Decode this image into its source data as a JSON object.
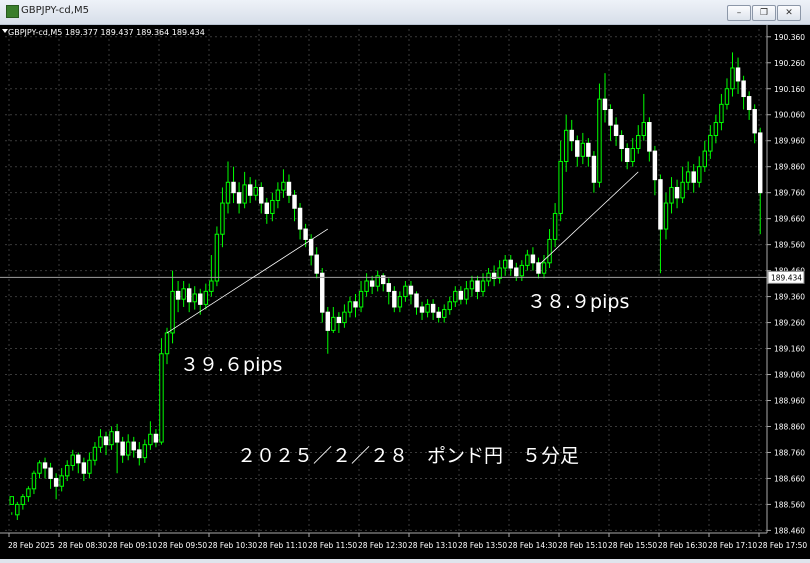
{
  "window": {
    "title": "GBPJPY-cd,M5",
    "buttons": [
      "minimize",
      "restore",
      "close"
    ]
  },
  "chart_data": {
    "type": "candlestick",
    "symbol_info": "GBPJPY-cd,M5  189.377 189.437 189.364 189.434",
    "ylim": [
      188.45,
      190.39
    ],
    "y_ticks": [
      "190.360",
      "190.260",
      "190.160",
      "190.060",
      "189.960",
      "189.860",
      "189.760",
      "189.660",
      "189.560",
      "189.460",
      "189.360",
      "189.260",
      "189.160",
      "189.060",
      "188.960",
      "188.860",
      "188.760",
      "188.660",
      "188.560",
      "188.460"
    ],
    "current_price": "189.434",
    "x_ticks": [
      "28 Feb 2025",
      "28 Feb 08:30",
      "28 Feb 09:10",
      "28 Feb 09:50",
      "28 Feb 10:30",
      "28 Feb 11:10",
      "28 Feb 11:50",
      "28 Feb 12:30",
      "28 Feb 13:10",
      "28 Feb 13:50",
      "28 Feb 14:30",
      "28 Feb 15:10",
      "28 Feb 15:50",
      "28 Feb 16:30",
      "28 Feb 17:10",
      "28 Feb 17:50"
    ],
    "candles": [
      [
        188.56,
        188.59,
        188.53,
        188.52
      ],
      [
        188.52,
        188.56,
        188.57,
        188.5
      ],
      [
        188.56,
        188.59,
        188.6,
        188.54
      ],
      [
        188.59,
        188.62,
        188.63,
        188.57
      ],
      [
        188.62,
        188.68,
        188.69,
        188.6
      ],
      [
        188.68,
        188.72,
        188.73,
        188.66
      ],
      [
        188.72,
        188.7,
        188.74,
        188.66
      ],
      [
        188.7,
        188.66,
        188.72,
        188.62
      ],
      [
        188.66,
        188.63,
        188.68,
        188.58
      ],
      [
        188.63,
        188.67,
        188.7,
        188.61
      ],
      [
        188.67,
        188.71,
        188.73,
        188.65
      ],
      [
        188.71,
        188.75,
        188.77,
        188.69
      ],
      [
        188.75,
        188.72,
        188.76,
        188.68
      ],
      [
        188.72,
        188.68,
        188.74,
        188.65
      ],
      [
        188.68,
        188.73,
        188.76,
        188.66
      ],
      [
        188.73,
        188.78,
        188.8,
        188.71
      ],
      [
        188.78,
        188.82,
        188.85,
        188.76
      ],
      [
        188.82,
        188.79,
        188.84,
        188.75
      ],
      [
        188.79,
        188.84,
        188.86,
        188.77
      ],
      [
        188.84,
        188.8,
        188.87,
        188.68
      ],
      [
        188.8,
        188.75,
        188.82,
        188.72
      ],
      [
        188.75,
        188.8,
        188.83,
        188.73
      ],
      [
        188.8,
        188.77,
        188.82,
        188.74
      ],
      [
        188.77,
        188.74,
        188.8,
        188.71
      ],
      [
        188.74,
        188.79,
        188.81,
        188.72
      ],
      [
        188.79,
        188.83,
        188.88,
        188.77
      ],
      [
        188.83,
        188.8,
        188.85,
        188.78
      ],
      [
        188.8,
        189.14,
        189.2,
        188.79
      ],
      [
        189.14,
        189.22,
        189.24,
        189.1
      ],
      [
        189.22,
        189.38,
        189.46,
        189.18
      ],
      [
        189.38,
        189.35,
        189.42,
        189.3
      ],
      [
        189.35,
        189.39,
        189.42,
        189.32
      ],
      [
        189.39,
        189.34,
        189.41,
        189.3
      ],
      [
        189.34,
        189.37,
        189.4,
        189.31
      ],
      [
        189.37,
        189.33,
        189.39,
        189.29
      ],
      [
        189.33,
        189.38,
        189.41,
        189.31
      ],
      [
        189.38,
        189.42,
        189.52,
        189.36
      ],
      [
        189.42,
        189.6,
        189.63,
        189.4
      ],
      [
        189.6,
        189.72,
        189.78,
        189.55
      ],
      [
        189.72,
        189.8,
        189.88,
        189.68
      ],
      [
        189.8,
        189.76,
        189.86,
        189.72
      ],
      [
        189.76,
        189.72,
        189.8,
        189.68
      ],
      [
        189.72,
        189.79,
        189.84,
        189.7
      ],
      [
        189.79,
        189.75,
        189.82,
        189.72
      ],
      [
        189.75,
        189.78,
        189.81,
        189.73
      ],
      [
        189.78,
        189.72,
        189.8,
        189.68
      ],
      [
        189.72,
        189.68,
        189.74,
        189.64
      ],
      [
        189.68,
        189.73,
        189.76,
        189.65
      ],
      [
        189.73,
        189.77,
        189.8,
        189.7
      ],
      [
        189.77,
        189.8,
        189.85,
        189.74
      ],
      [
        189.8,
        189.75,
        189.83,
        189.72
      ],
      [
        189.75,
        189.7,
        189.77,
        189.65
      ],
      [
        189.7,
        189.62,
        189.72,
        189.58
      ],
      [
        189.62,
        189.58,
        189.64,
        189.55
      ],
      [
        189.58,
        189.52,
        189.6,
        189.48
      ],
      [
        189.52,
        189.45,
        189.55,
        189.43
      ],
      [
        189.45,
        189.3,
        189.47,
        189.26
      ],
      [
        189.3,
        189.23,
        189.32,
        189.14
      ],
      [
        189.23,
        189.28,
        189.32,
        189.22
      ],
      [
        189.28,
        189.26,
        189.3,
        189.22
      ],
      [
        189.26,
        189.3,
        189.33,
        189.24
      ],
      [
        189.3,
        189.34,
        189.36,
        189.28
      ],
      [
        189.34,
        189.32,
        189.37,
        189.28
      ],
      [
        189.32,
        189.38,
        189.42,
        189.3
      ],
      [
        189.38,
        189.42,
        189.45,
        189.36
      ],
      [
        189.42,
        189.4,
        189.44,
        189.37
      ],
      [
        189.4,
        189.44,
        189.46,
        189.38
      ],
      [
        189.44,
        189.41,
        189.45,
        189.38
      ],
      [
        189.41,
        189.38,
        189.43,
        189.33
      ],
      [
        189.38,
        189.32,
        189.4,
        189.3
      ],
      [
        189.32,
        189.36,
        189.38,
        189.3
      ],
      [
        189.36,
        189.4,
        189.42,
        189.34
      ],
      [
        189.4,
        189.37,
        189.42,
        189.33
      ],
      [
        189.37,
        189.32,
        189.38,
        189.29
      ],
      [
        189.32,
        189.3,
        189.34,
        189.27
      ],
      [
        189.3,
        189.33,
        189.35,
        189.28
      ],
      [
        189.33,
        189.3,
        189.35,
        189.27
      ],
      [
        189.3,
        189.28,
        189.32,
        189.26
      ],
      [
        189.28,
        189.31,
        189.33,
        189.26
      ],
      [
        189.31,
        189.34,
        189.36,
        189.29
      ],
      [
        189.34,
        189.38,
        189.4,
        189.32
      ],
      [
        189.38,
        189.35,
        189.4,
        189.33
      ],
      [
        189.35,
        189.39,
        189.42,
        189.33
      ],
      [
        189.39,
        189.42,
        189.44,
        189.36
      ],
      [
        189.42,
        189.38,
        189.44,
        189.35
      ],
      [
        189.38,
        189.42,
        189.45,
        189.36
      ],
      [
        189.42,
        189.45,
        189.47,
        189.4
      ],
      [
        189.45,
        189.43,
        189.48,
        189.4
      ],
      [
        189.43,
        189.47,
        189.5,
        189.41
      ],
      [
        189.47,
        189.5,
        189.52,
        189.44
      ],
      [
        189.5,
        189.47,
        189.52,
        189.44
      ],
      [
        189.47,
        189.44,
        189.49,
        189.42
      ],
      [
        189.44,
        189.48,
        189.5,
        189.42
      ],
      [
        189.48,
        189.52,
        189.54,
        189.46
      ],
      [
        189.52,
        189.49,
        189.55,
        189.46
      ],
      [
        189.49,
        189.45,
        189.51,
        189.43
      ],
      [
        189.45,
        189.49,
        189.52,
        189.43
      ],
      [
        189.49,
        189.58,
        189.62,
        189.47
      ],
      [
        189.58,
        189.68,
        189.72,
        189.55
      ],
      [
        189.68,
        189.88,
        189.96,
        189.65
      ],
      [
        189.88,
        190.0,
        190.06,
        189.84
      ],
      [
        190.0,
        189.96,
        190.04,
        189.92
      ],
      [
        189.96,
        189.9,
        189.98,
        189.86
      ],
      [
        189.9,
        189.95,
        189.99,
        189.87
      ],
      [
        189.95,
        189.9,
        189.97,
        189.86
      ],
      [
        189.9,
        189.8,
        189.92,
        189.76
      ],
      [
        189.8,
        190.12,
        190.18,
        189.78
      ],
      [
        190.12,
        190.08,
        190.22,
        190.03
      ],
      [
        190.08,
        190.02,
        190.1,
        189.96
      ],
      [
        190.02,
        189.98,
        190.05,
        189.94
      ],
      [
        189.98,
        189.93,
        190.0,
        189.88
      ],
      [
        189.93,
        189.88,
        189.95,
        189.85
      ],
      [
        189.88,
        189.93,
        189.97,
        189.86
      ],
      [
        189.93,
        189.98,
        190.02,
        189.91
      ],
      [
        189.98,
        190.03,
        190.14,
        189.96
      ],
      [
        190.03,
        189.92,
        190.05,
        189.88
      ],
      [
        189.92,
        189.81,
        189.94,
        189.75
      ],
      [
        189.81,
        189.62,
        189.83,
        189.45
      ],
      [
        189.62,
        189.72,
        189.76,
        189.58
      ],
      [
        189.72,
        189.78,
        189.82,
        189.68
      ],
      [
        189.78,
        189.74,
        189.81,
        189.7
      ],
      [
        189.74,
        189.8,
        189.86,
        189.72
      ],
      [
        189.8,
        189.84,
        189.88,
        189.77
      ],
      [
        189.84,
        189.8,
        189.87,
        189.76
      ],
      [
        189.8,
        189.86,
        189.9,
        189.78
      ],
      [
        189.86,
        189.92,
        189.96,
        189.84
      ],
      [
        189.92,
        189.98,
        190.02,
        189.89
      ],
      [
        189.98,
        190.03,
        190.06,
        189.95
      ],
      [
        190.03,
        190.1,
        190.14,
        190.0
      ],
      [
        190.1,
        190.16,
        190.2,
        190.08
      ],
      [
        190.16,
        190.24,
        190.3,
        190.13
      ],
      [
        190.24,
        190.19,
        190.28,
        190.14
      ],
      [
        190.19,
        190.13,
        190.21,
        190.08
      ],
      [
        190.13,
        190.08,
        190.15,
        190.04
      ],
      [
        190.08,
        189.99,
        190.1,
        189.95
      ],
      [
        189.99,
        189.76,
        190.01,
        189.6
      ]
    ],
    "annotations": [
      "３９.６pips",
      "３８.９pips",
      "２０２５／２／２８　ポンド円　５分足"
    ]
  }
}
